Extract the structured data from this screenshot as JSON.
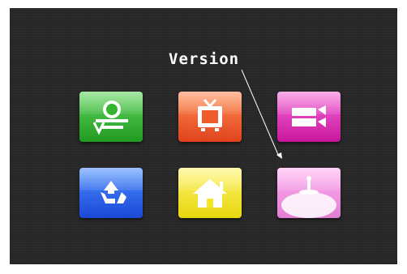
{
  "callout": {
    "label": "Version"
  },
  "menu": {
    "tiles": [
      {
        "icon": "bell-tool-icon",
        "color": "#2fb52a"
      },
      {
        "icon": "tv-icon",
        "color": "#f05a28"
      },
      {
        "icon": "video-camera-icon",
        "color": "#e43ac0"
      },
      {
        "icon": "recycle-icon",
        "color": "#2a66e8"
      },
      {
        "icon": "home-icon",
        "color": "#f3e622"
      },
      {
        "icon": "version-info-icon",
        "color": "#f5a3e8"
      }
    ]
  }
}
